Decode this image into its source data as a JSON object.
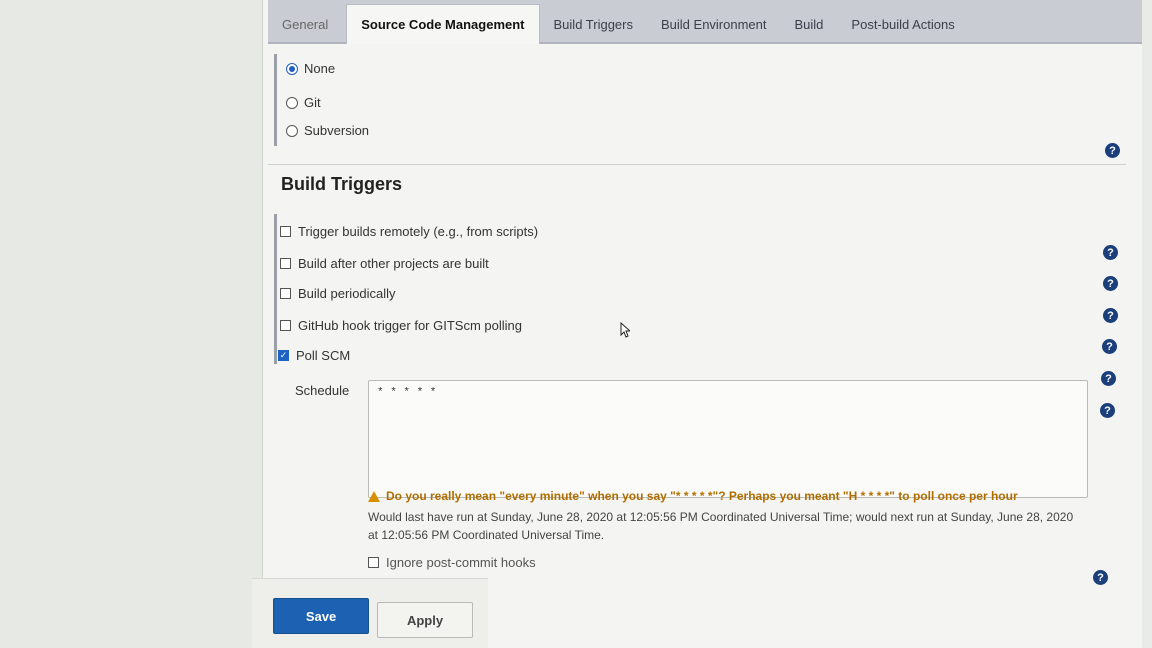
{
  "tabs": [
    "General",
    "Source Code Management",
    "Build Triggers",
    "Build Environment",
    "Build",
    "Post-build Actions"
  ],
  "active_tab": "Source Code Management",
  "scm": {
    "options": [
      "None",
      "Git",
      "Subversion"
    ],
    "selected": "None"
  },
  "build_triggers": {
    "title": "Build Triggers",
    "options": [
      {
        "label": "Trigger builds remotely (e.g., from scripts)",
        "checked": false
      },
      {
        "label": "Build after other projects are built",
        "checked": false
      },
      {
        "label": "Build periodically",
        "checked": false
      },
      {
        "label": "GitHub hook trigger for GITScm polling",
        "checked": false
      },
      {
        "label": "Poll SCM",
        "checked": true
      }
    ],
    "schedule_label": "Schedule",
    "schedule_value": "* * * * *",
    "warning": "Do you really mean \"every minute\" when you say \"* * * * *\"? Perhaps you meant \"H * * * *\" to poll once per hour",
    "info": "Would last have run at Sunday, June 28, 2020 at 12:05:56 PM Coordinated Universal Time; would next run at Sunday, June 28, 2020 at 12:05:56 PM Coordinated Universal Time.",
    "ignore_hooks_label": "Ignore post-commit hooks",
    "ignore_hooks_checked": false
  },
  "buttons": {
    "save": "Save",
    "apply": "Apply"
  },
  "help_icon_glyph": "?",
  "colors": {
    "accent": "#1d61b3",
    "warning": "#b26d00",
    "help": "#1a3f7a"
  }
}
